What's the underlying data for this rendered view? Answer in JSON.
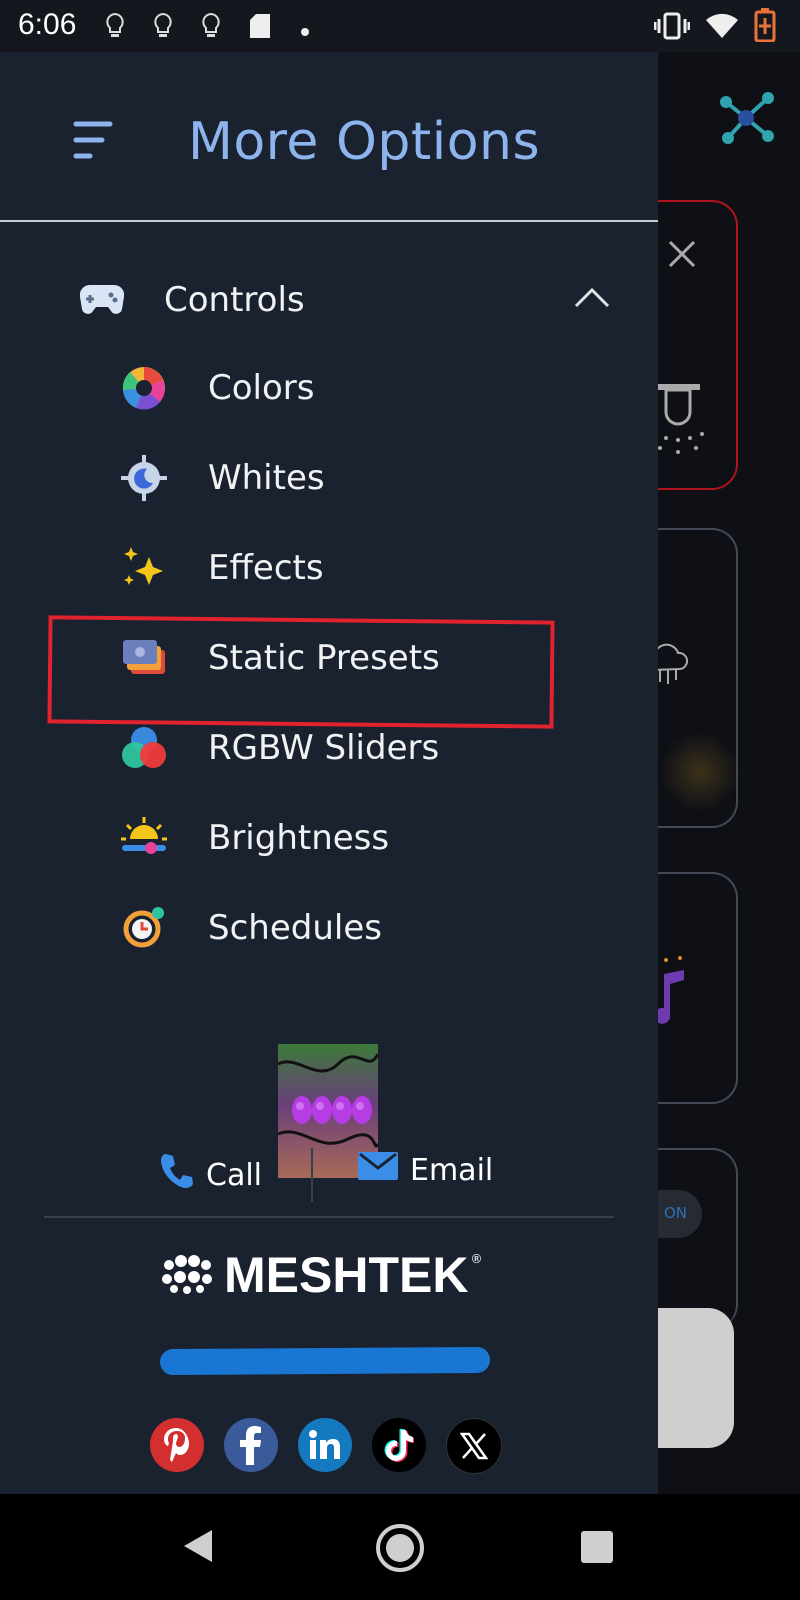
{
  "status_bar": {
    "time": "6:06",
    "left_icons": [
      "lightbulb-icon",
      "lightbulb-icon",
      "lightbulb-icon",
      "sd-card-icon",
      "dot-icon"
    ],
    "right_icons": [
      "vibrate-icon",
      "wifi-icon",
      "battery-charging-icon"
    ]
  },
  "drawer": {
    "title": "More Options",
    "section": {
      "label": "Controls",
      "icon": "gamepad-icon",
      "expanded": true
    },
    "items": [
      {
        "label": "Colors",
        "icon": "color-wheel-icon"
      },
      {
        "label": "Whites",
        "icon": "whites-icon"
      },
      {
        "label": "Effects",
        "icon": "sparkles-icon"
      },
      {
        "label": "Static Presets",
        "icon": "presets-icon",
        "highlighted": true
      },
      {
        "label": "RGBW Sliders",
        "icon": "rgbw-icon"
      },
      {
        "label": "Brightness",
        "icon": "brightness-icon"
      },
      {
        "label": "Schedules",
        "icon": "schedule-icon"
      }
    ],
    "contact": {
      "call_label": "Call",
      "email_label": "Email"
    },
    "brand": {
      "name": "MESHTEK",
      "mark": "®"
    },
    "social": [
      "pinterest-icon",
      "facebook-icon",
      "linkedin-icon",
      "tiktok-icon",
      "x-icon"
    ]
  },
  "background_app": {
    "toggle_label": "ON"
  },
  "colors": {
    "drawer_bg": "#1a2230",
    "title": "#8eb4ee",
    "highlight": "#e0232e",
    "redaction": "#1976d2"
  }
}
